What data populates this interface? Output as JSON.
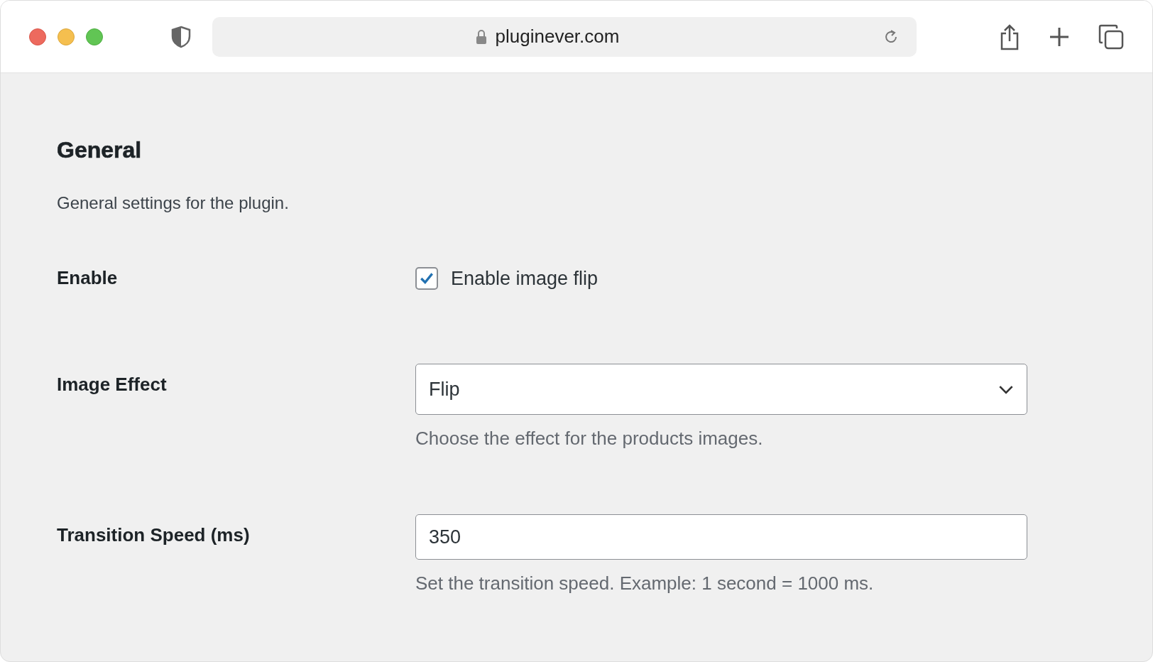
{
  "browser": {
    "address": "pluginever.com"
  },
  "section": {
    "title": "General",
    "description": "General settings for the plugin."
  },
  "fields": [
    {
      "kind": "checkbox",
      "label": "Enable",
      "option": "Enable image flip",
      "checked": true
    },
    {
      "kind": "select",
      "label": "Image Effect",
      "value": "Flip",
      "help": "Choose the effect for the products images."
    },
    {
      "kind": "text",
      "label": "Transition Speed (ms)",
      "value": "350",
      "help": "Set the transition speed. Example: 1 second = 1000 ms."
    }
  ]
}
